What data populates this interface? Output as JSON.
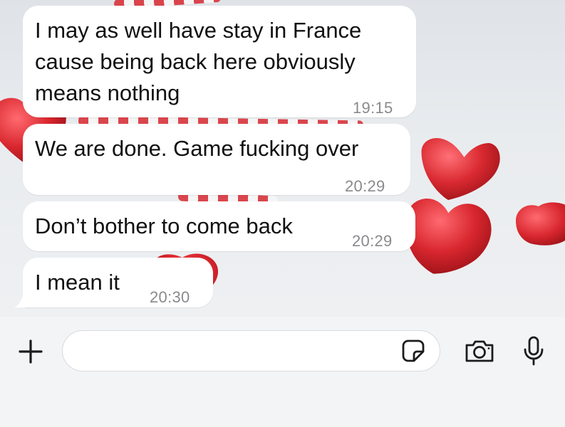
{
  "messages": [
    {
      "text": "I may as well have stay in France\ncause being back here obviously\nmeans nothing",
      "time": "19:15"
    },
    {
      "text": "We are done. Game fucking over",
      "time": "20:29"
    },
    {
      "text": "Don’t bother to come back",
      "time": "20:29"
    },
    {
      "text": "I mean it",
      "time": "20:30"
    }
  ],
  "composer": {
    "input_value": "",
    "add_icon": "plus-icon",
    "sticker_icon": "sticker-icon",
    "camera_icon": "camera-icon",
    "mic_icon": "microphone-icon"
  },
  "wallpaper": {
    "theme": "red candy hearts and candy canes on white snow",
    "accent_color": "#d8262e"
  },
  "colors": {
    "bubble": "#ffffff",
    "timestamp": "#8a8a8e",
    "icon": "#1c1c1e",
    "composer_bg": "#f3f4f6"
  }
}
